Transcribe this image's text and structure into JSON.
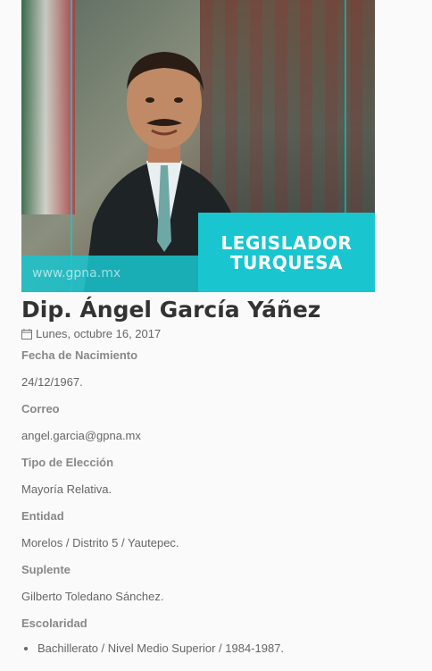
{
  "hero": {
    "banner_line1": "LEGISLADOR",
    "banner_line2": "TURQUESA",
    "watermark": "www.gpna.mx",
    "accent_color": "#19c6cf"
  },
  "profile": {
    "name": "Dip. Ángel García Yáñez",
    "date": "Lunes, octubre 16, 2017",
    "fields": [
      {
        "label": "Fecha de Nacimiento",
        "value": "24/12/1967."
      },
      {
        "label": "Correo",
        "value": "angel.garcia@gpna.mx"
      },
      {
        "label": "Tipo de Elección",
        "value": "Mayoría Relativa."
      },
      {
        "label": "Entidad",
        "value": "Morelos / Distrito 5 / Yautepec."
      },
      {
        "label": "Suplente",
        "value": "Gilberto Toledano Sánchez."
      },
      {
        "label": "Escolaridad",
        "value": ""
      }
    ],
    "education": [
      "Bachillerato / Nivel Medio Superior / 1984-1987."
    ]
  }
}
